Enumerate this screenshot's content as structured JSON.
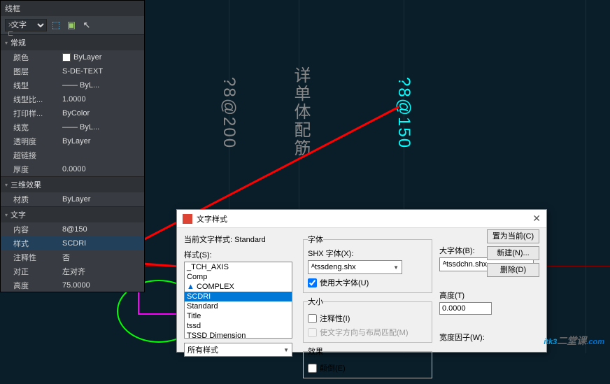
{
  "panel": {
    "title": "线框",
    "toolbar": {
      "select": "文字"
    },
    "sections": {
      "general": {
        "label": "常规",
        "props": {
          "color_label": "颜色",
          "color_value": "ByLayer",
          "layer_label": "图层",
          "layer_value": "S-DE-TEXT",
          "linetype_label": "线型",
          "linetype_value": "—— ByL...",
          "lscale_label": "线型比...",
          "lscale_value": "1.0000",
          "plotstyle_label": "打印样...",
          "plotstyle_value": "ByColor",
          "lweight_label": "线宽",
          "lweight_value": "—— ByL...",
          "trans_label": "透明度",
          "trans_value": "ByLayer",
          "hyperlink_label": "超链接",
          "hyperlink_value": "",
          "thick_label": "厚度",
          "thick_value": "0.0000"
        }
      },
      "3d": {
        "label": "三维效果",
        "material_label": "材质",
        "material_value": "ByLayer"
      },
      "text": {
        "label": "文字",
        "content_label": "内容",
        "content_value": "8@150",
        "style_label": "样式",
        "style_value": "SCDRI",
        "annot_label": "注释性",
        "annot_value": "否",
        "align_label": "对正",
        "align_value": "左对齐",
        "height_label": "高度",
        "height_value": "75.0000"
      }
    }
  },
  "canvas": {
    "text1": "?8@200",
    "text2": "详单体配筋",
    "text3": "?8@150"
  },
  "dialog": {
    "title": "文字样式",
    "current_label": "当前文字样式:",
    "current_value": "Standard",
    "style_label": "样式(S):",
    "styles": [
      "_TCH_AXIS",
      "Comp",
      "COMPLEX",
      "SCDRI",
      "Standard",
      "Title",
      "tssd",
      "TSSD Dimension"
    ],
    "selected_style": "SCDRI",
    "filter": "所有样式",
    "font_section": "字体",
    "shx_label": "SHX 字体(X):",
    "shx_value": "tssdeng.shx",
    "big_label": "大字体(B):",
    "big_value": "tssdchn.shx",
    "use_big_label": "使用大字体(U)",
    "size_section": "大小",
    "annot_label": "注释性(I)",
    "match_label": "使文字方向与布局匹配(M)",
    "height_label": "高度(T)",
    "height_value": "0.0000",
    "effect_section": "效果",
    "upside_label": "颠倒(E)",
    "width_label": "宽度因子(W):",
    "buttons": {
      "current": "置为当前(C)",
      "new": "新建(N)...",
      "delete": "删除(D)"
    }
  },
  "watermark": {
    "brand": "itk3",
    "sub1": "二堂课",
    "ext": ".com"
  }
}
